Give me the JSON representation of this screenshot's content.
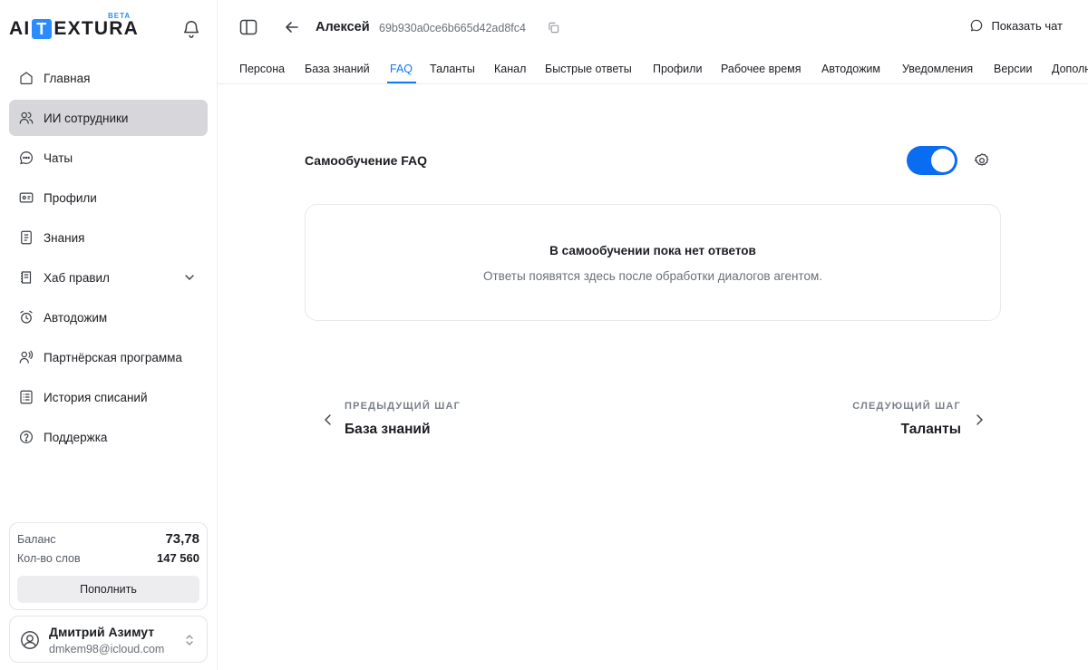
{
  "brand": {
    "logo_left": "AI",
    "logo_box": "T",
    "logo_right": "EXTURA",
    "badge": "BETA"
  },
  "sidebar": {
    "items": [
      {
        "label": "Главная",
        "icon": "home-icon"
      },
      {
        "label": "ИИ сотрудники",
        "icon": "users-icon",
        "active": true
      },
      {
        "label": "Чаты",
        "icon": "chat-icon"
      },
      {
        "label": "Профили",
        "icon": "id-card-icon"
      },
      {
        "label": "Знания",
        "icon": "book-icon"
      },
      {
        "label": "Хаб правил",
        "icon": "rules-icon",
        "expandable": true
      },
      {
        "label": "Автодожим",
        "icon": "alarm-icon"
      },
      {
        "label": "Партнёрская программа",
        "icon": "partner-icon"
      },
      {
        "label": "История списаний",
        "icon": "history-icon"
      },
      {
        "label": "Поддержка",
        "icon": "help-icon"
      }
    ],
    "balance": {
      "label": "Баланс",
      "value": "73,78",
      "words_label": "Кол-во слов",
      "words_value": "147 560",
      "topup_label": "Пополнить"
    },
    "user": {
      "name": "Дмитрий Азимут",
      "email": "dmkem98@icloud.com"
    }
  },
  "header": {
    "agent_name": "Алексей",
    "agent_id": "69b930a0ce6b665d42ad8fc4",
    "show_chat_label": "Показать чат"
  },
  "tabs": [
    {
      "label": "Персона"
    },
    {
      "label": "База знаний"
    },
    {
      "label": "FAQ",
      "active": true
    },
    {
      "label": "Таланты"
    },
    {
      "label": "Канал"
    },
    {
      "label": "Быстрые ответы"
    },
    {
      "label": "Профили"
    },
    {
      "label": "Рабочее время"
    },
    {
      "label": "Автодожим"
    },
    {
      "label": "Уведомления"
    },
    {
      "label": "Версии"
    },
    {
      "label": "Дополн"
    }
  ],
  "faq": {
    "title": "Самообучение FAQ",
    "toggle_on": true,
    "empty_title": "В самообучении пока нет ответов",
    "empty_desc": "Ответы появятся здесь после обработки диалогов агентом."
  },
  "steps": {
    "prev_caption": "ПРЕДЫДУЩИЙ ШАГ",
    "prev_name": "База знаний",
    "next_caption": "СЛЕДУЮЩИЙ ШАГ",
    "next_name": "Таланты"
  },
  "colors": {
    "accent": "#1478f0",
    "toggle": "#0a6cf0",
    "logo_accent": "#2a8cff",
    "active_nav_bg": "#d7d7db"
  }
}
